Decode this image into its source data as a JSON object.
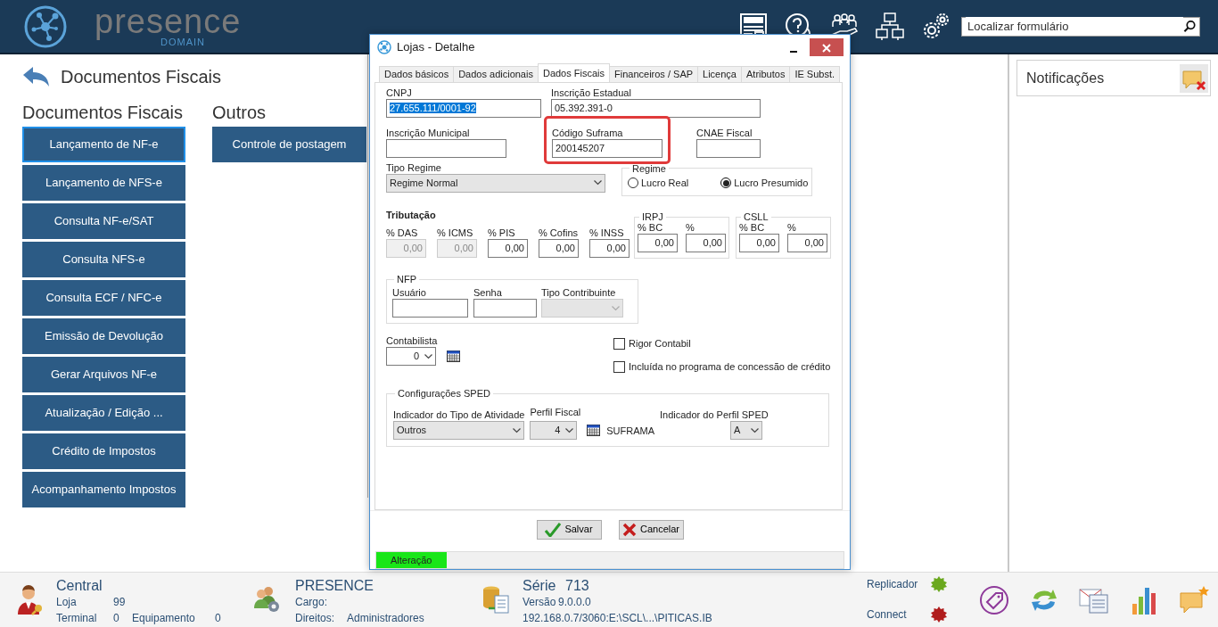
{
  "header": {
    "logo": "presence",
    "logo_sub": "DOMAIN",
    "search": {
      "placeholder": "Localizar formulário"
    }
  },
  "page": {
    "title": "Documentos Fiscais",
    "groups": [
      {
        "heading": "Documentos Fiscais",
        "buttons": [
          {
            "label": "Lançamento de NF-e",
            "selected": true
          },
          {
            "label": "Lançamento de NFS-e",
            "selected": false
          },
          {
            "label": "Consulta NF-e/SAT",
            "selected": false
          },
          {
            "label": "Consulta NFS-e",
            "selected": false
          },
          {
            "label": "Consulta ECF / NFC-e",
            "selected": false
          },
          {
            "label": "Emissão de Devolução",
            "selected": false
          },
          {
            "label": "Gerar Arquivos NF-e",
            "selected": false
          },
          {
            "label": "Atualização / Edição ...",
            "selected": false
          },
          {
            "label": "Crédito de Impostos",
            "selected": false
          },
          {
            "label": "Acompanhamento Impostos",
            "selected": false
          }
        ]
      },
      {
        "heading": "Outros",
        "buttons": [
          {
            "label": "Controle de postagem",
            "selected": false
          }
        ]
      }
    ]
  },
  "notifications": {
    "title": "Notificações"
  },
  "dialog": {
    "title": "Lojas - Detalhe",
    "tabs": [
      {
        "label": "Dados básicos",
        "selected": false
      },
      {
        "label": "Dados adicionais",
        "selected": false
      },
      {
        "label": "Dados Fiscais",
        "selected": true
      },
      {
        "label": "Financeiros / SAP",
        "selected": false
      },
      {
        "label": "Licença",
        "selected": false
      },
      {
        "label": "Atributos",
        "selected": false
      },
      {
        "label": "IE Subst.",
        "selected": false
      }
    ],
    "cnpj": {
      "label": "CNPJ",
      "value": "27.655.111/0001-92",
      "text_selected": true
    },
    "inscricao_estadual": {
      "label": "Inscrição Estadual",
      "value": "05.392.391-0"
    },
    "inscricao_municipal": {
      "label": "Inscrição Municipal"
    },
    "codigo_suframa": {
      "label": "Código Suframa",
      "value": "200145207",
      "highlighted": true
    },
    "cnae_fiscal": {
      "label": "CNAE Fiscal"
    },
    "tipo_regime": {
      "label": "Tipo Regime",
      "value": "Regime Normal"
    },
    "regime": {
      "legend": "Regime",
      "options": [
        {
          "label": "Lucro Real",
          "selected": false
        },
        {
          "label": "Lucro Presumido",
          "selected": true
        }
      ]
    },
    "tributacao": {
      "title": "Tributação",
      "fields": [
        {
          "label": "% DAS",
          "value": "0,00",
          "disabled": true
        },
        {
          "label": "% ICMS",
          "value": "0,00",
          "disabled": true
        },
        {
          "label": "% PIS",
          "value": "0,00",
          "disabled": false
        },
        {
          "label": "% Cofins",
          "value": "0,00",
          "disabled": false
        },
        {
          "label": "% INSS",
          "value": "0,00",
          "disabled": false
        }
      ]
    },
    "irpj": {
      "legend": "IRPJ",
      "fields": [
        {
          "label": "% BC",
          "value": "0,00",
          "disabled": false
        },
        {
          "label": "%",
          "value": "0,00",
          "disabled": false
        }
      ]
    },
    "csll": {
      "legend": "CSLL",
      "fields": [
        {
          "label": "% BC",
          "value": "0,00",
          "disabled": false
        },
        {
          "label": "%",
          "value": "0,00",
          "disabled": false
        }
      ]
    },
    "nfp": {
      "legend": "NFP",
      "usuario": {
        "label": "Usuário"
      },
      "senha": {
        "label": "Senha"
      },
      "tipo_contribuinte": {
        "label": "Tipo Contribuinte",
        "disabled": true
      }
    },
    "contabilista": {
      "label": "Contabilista",
      "value": "0"
    },
    "checkboxes": [
      {
        "label": "Rigor Contabil",
        "checked": false
      },
      {
        "label": "Incluída no programa de concessão de crédito",
        "checked": false
      }
    ],
    "sped": {
      "legend": "Configurações SPED",
      "tipo_atividade": {
        "label": "Indicador do Tipo de Atividade",
        "value": "Outros"
      },
      "perfil_fiscal": {
        "label": "Perfil Fiscal",
        "value": "4"
      },
      "suframa_text": "SUFRAMA",
      "perfil_sped": {
        "label": "Indicador do Perfil SPED",
        "value": "A"
      }
    },
    "buttons": [
      {
        "label": "Salvar",
        "kind": "save"
      },
      {
        "label": "Cancelar",
        "kind": "cancel"
      }
    ],
    "mode": "Alteração"
  },
  "status_bar": {
    "store": {
      "name": "Central",
      "loja_label": "Loja",
      "loja": "99",
      "terminal_label": "Terminal",
      "terminal": "0",
      "equipamento_label": "Equipamento",
      "equipamento": "0"
    },
    "user": {
      "name": "PRESENCE",
      "cargo_label": "Cargo:",
      "direitos_label": "Direitos:",
      "direitos": "Administradores"
    },
    "server": {
      "serie_label": "Série",
      "serie": "713",
      "versao_label": "Versão",
      "versao": "9.0.0.0",
      "path": "192.168.0.7/3060:E:\\SCL\\...\\PITICAS.IB"
    },
    "services": [
      {
        "name": "Replicador",
        "color": "#6aa81e"
      },
      {
        "name": "Connect",
        "color": "#b01c1c"
      }
    ]
  }
}
